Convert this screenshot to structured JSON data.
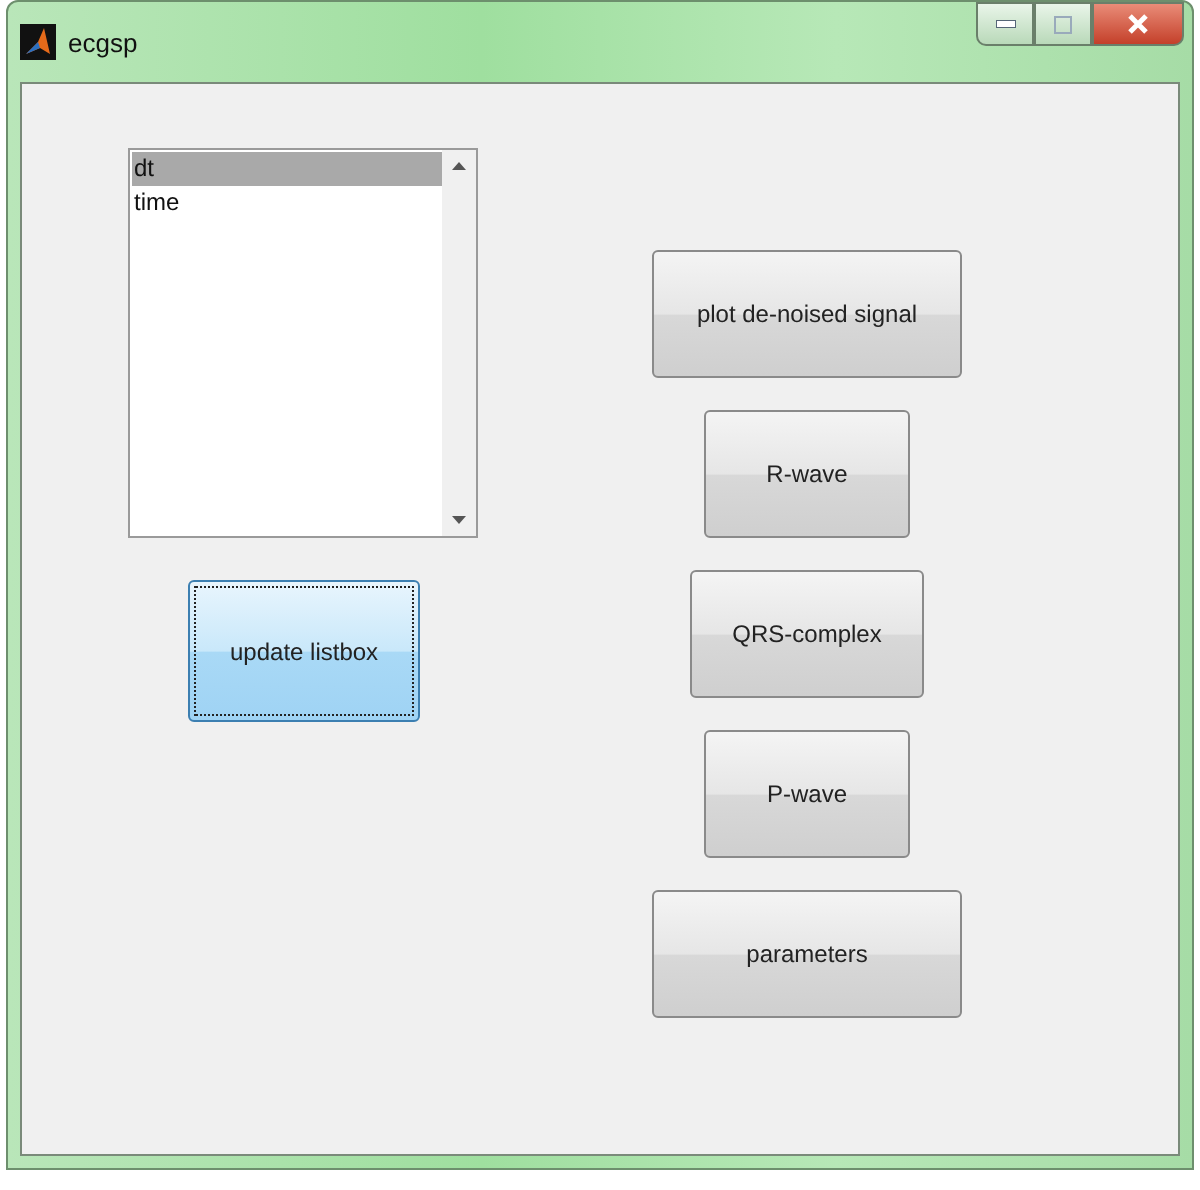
{
  "window": {
    "title": "ecgsp"
  },
  "listbox": {
    "items": [
      {
        "label": "dt",
        "selected": true
      },
      {
        "label": "time",
        "selected": false
      }
    ]
  },
  "update_button": {
    "label": "update listbox",
    "focused": true
  },
  "buttons": [
    {
      "label": "plot de-noised signal",
      "focused": false
    },
    {
      "label": "R-wave",
      "focused": false
    },
    {
      "label": "QRS-complex",
      "focused": false
    },
    {
      "label": "P-wave",
      "focused": false
    },
    {
      "label": "parameters",
      "focused": false
    }
  ]
}
